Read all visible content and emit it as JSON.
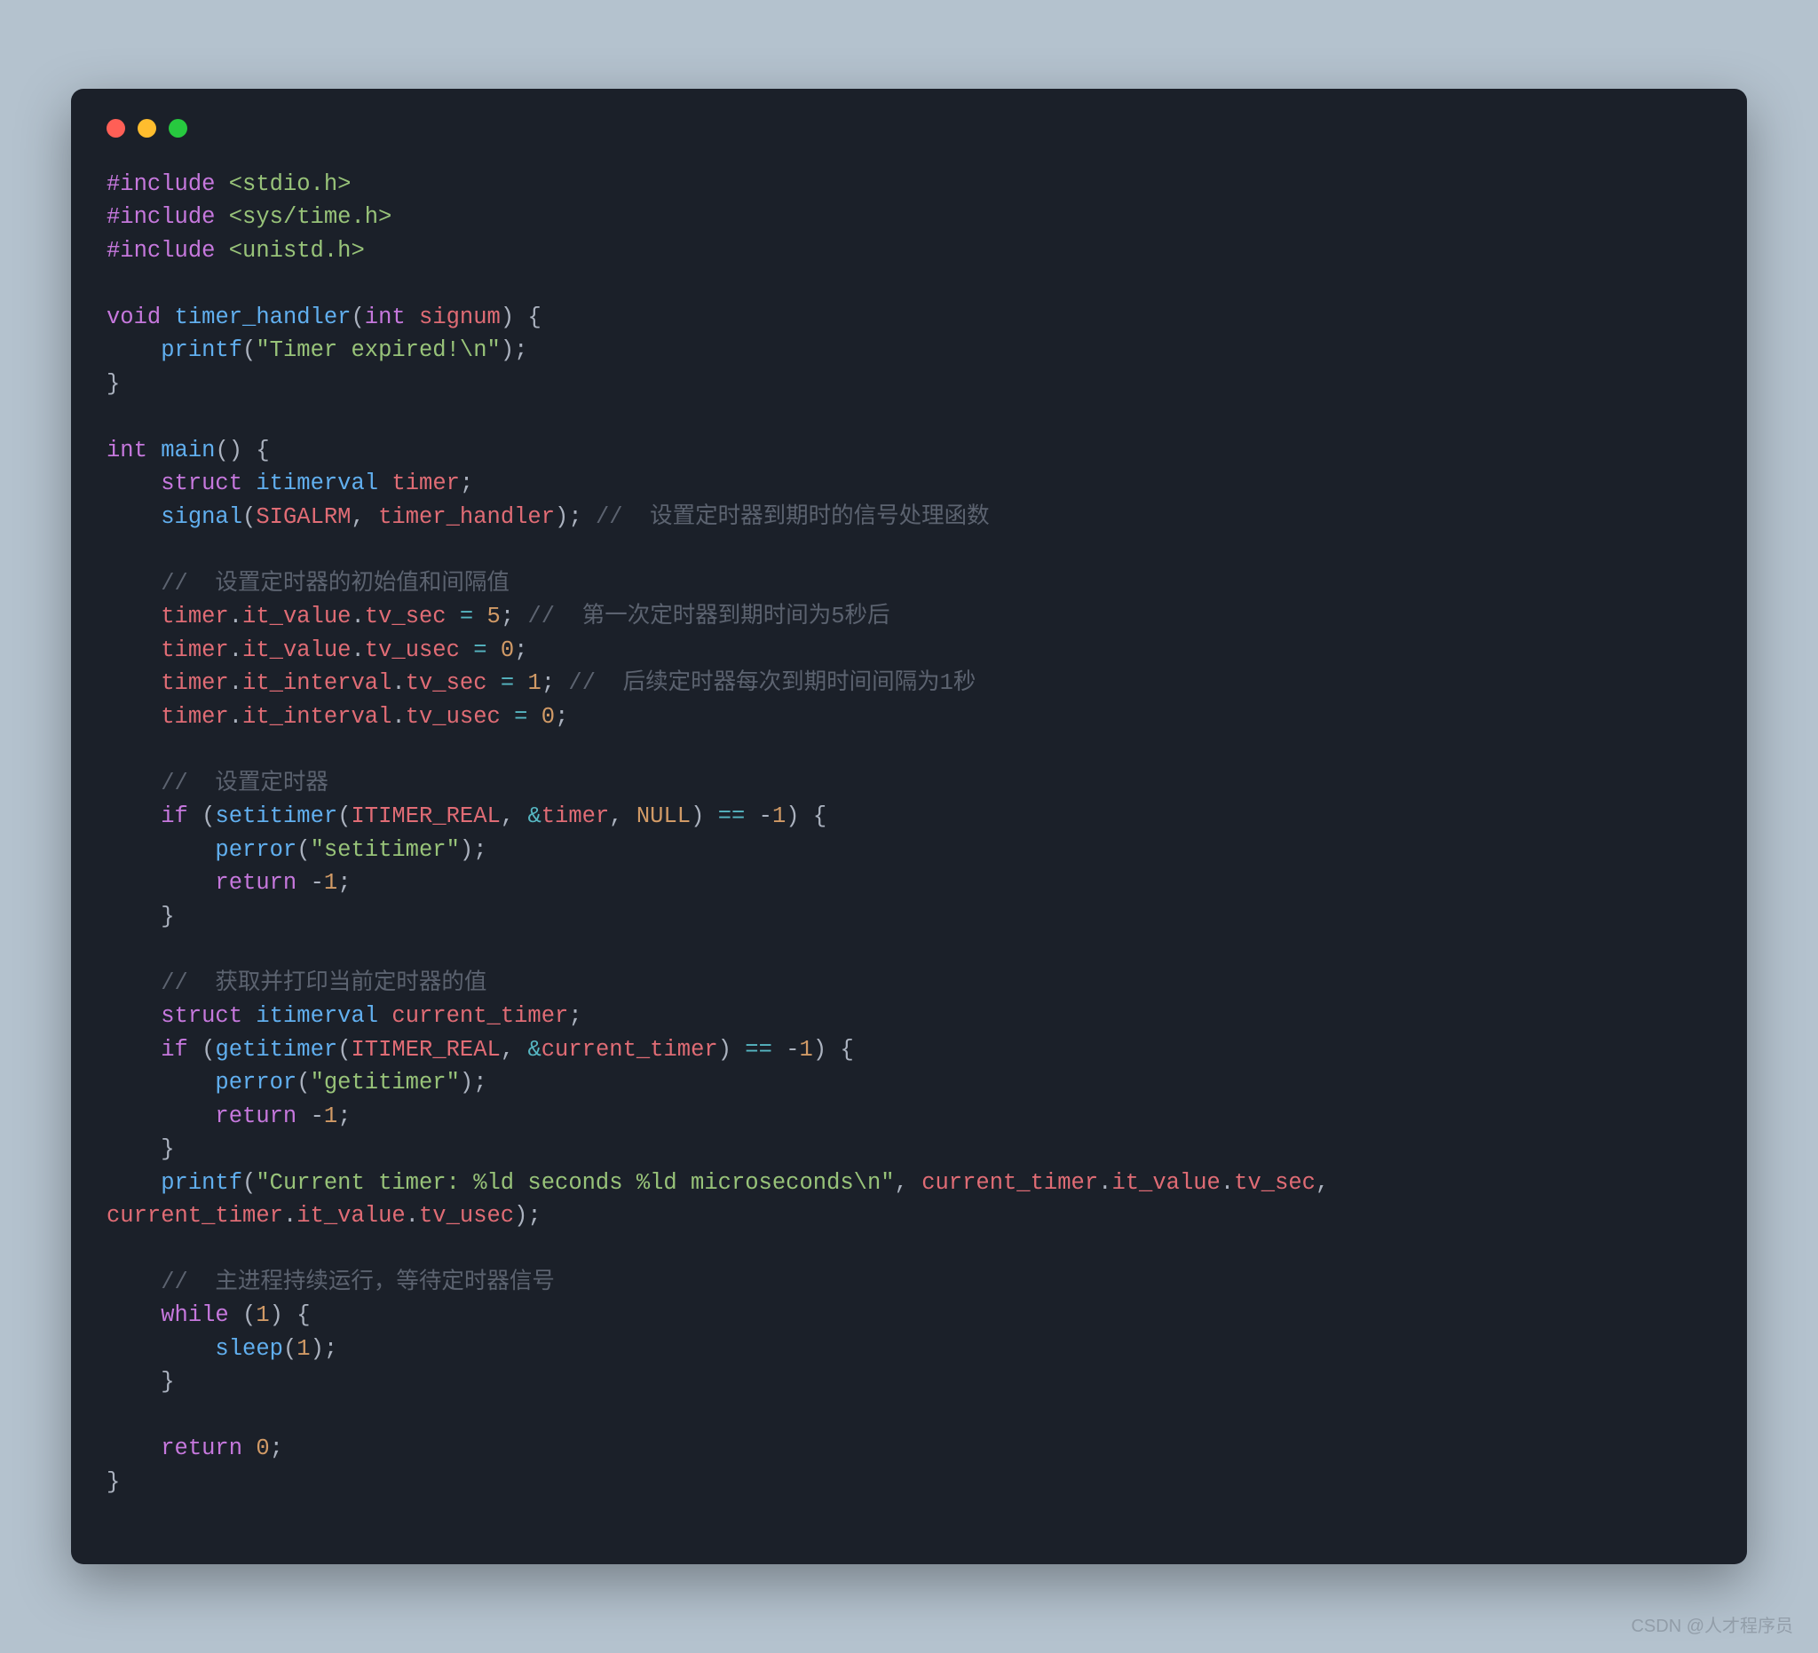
{
  "window": {
    "controls": [
      "close",
      "minimize",
      "maximize"
    ]
  },
  "code": {
    "includes": [
      {
        "directive": "#include",
        "header": "<stdio.h>"
      },
      {
        "directive": "#include",
        "header": "<sys/time.h>"
      },
      {
        "directive": "#include",
        "header": "<unistd.h>"
      }
    ],
    "handler": {
      "ret": "void",
      "name": "timer_handler",
      "param_type": "int",
      "param_name": "signum",
      "body_fn": "printf",
      "body_str": "\"Timer expired!\\n\""
    },
    "main": {
      "ret": "int",
      "name": "main",
      "decl_kw": "struct",
      "decl_type": "itimerval",
      "decl_name": "timer",
      "signal_fn": "signal",
      "signal_arg1": "SIGALRM",
      "signal_arg2": "timer_handler",
      "signal_comment": "//  设置定时器到期时的信号处理函数",
      "comment_init": "//  设置定时器的初始值和间隔值",
      "assign1_obj": "timer",
      "assign1_f1": "it_value",
      "assign1_f2": "tv_sec",
      "assign1_val": "5",
      "assign1_comment": "//  第一次定时器到期时间为5秒后",
      "assign2_obj": "timer",
      "assign2_f1": "it_value",
      "assign2_f2": "tv_usec",
      "assign2_val": "0",
      "assign3_obj": "timer",
      "assign3_f1": "it_interval",
      "assign3_f2": "tv_sec",
      "assign3_val": "1",
      "assign3_comment": "//  后续定时器每次到期时间间隔为1秒",
      "assign4_obj": "timer",
      "assign4_f1": "it_interval",
      "assign4_f2": "tv_usec",
      "assign4_val": "0",
      "comment_set": "//  设置定时器",
      "if_kw": "if",
      "set_fn": "setitimer",
      "set_arg1": "ITIMER_REAL",
      "set_arg2": "timer",
      "set_arg3": "NULL",
      "cmp_val": "-1",
      "perror_fn": "perror",
      "perror_str1": "\"setitimer\"",
      "return_kw": "return",
      "return_val": "-1",
      "comment_get": "//  获取并打印当前定时器的值",
      "decl2_kw": "struct",
      "decl2_type": "itimerval",
      "decl2_name": "current_timer",
      "get_fn": "getitimer",
      "get_arg1": "ITIMER_REAL",
      "get_arg2": "current_timer",
      "perror_str2": "\"getitimer\"",
      "printf_fn": "printf",
      "printf_str": "\"Current timer: %ld seconds %ld microseconds\\n\"",
      "printf_a1_obj": "current_timer",
      "printf_a1_f1": "it_value",
      "printf_a1_f2": "tv_sec",
      "printf_a2_obj": "current_timer",
      "printf_a2_f1": "it_value",
      "printf_a2_f2": "tv_usec",
      "comment_loop": "//  主进程持续运行，等待定时器信号",
      "while_kw": "while",
      "while_cond": "1",
      "sleep_fn": "sleep",
      "sleep_arg": "1",
      "return0": "0"
    }
  },
  "watermark": "CSDN @人才程序员"
}
